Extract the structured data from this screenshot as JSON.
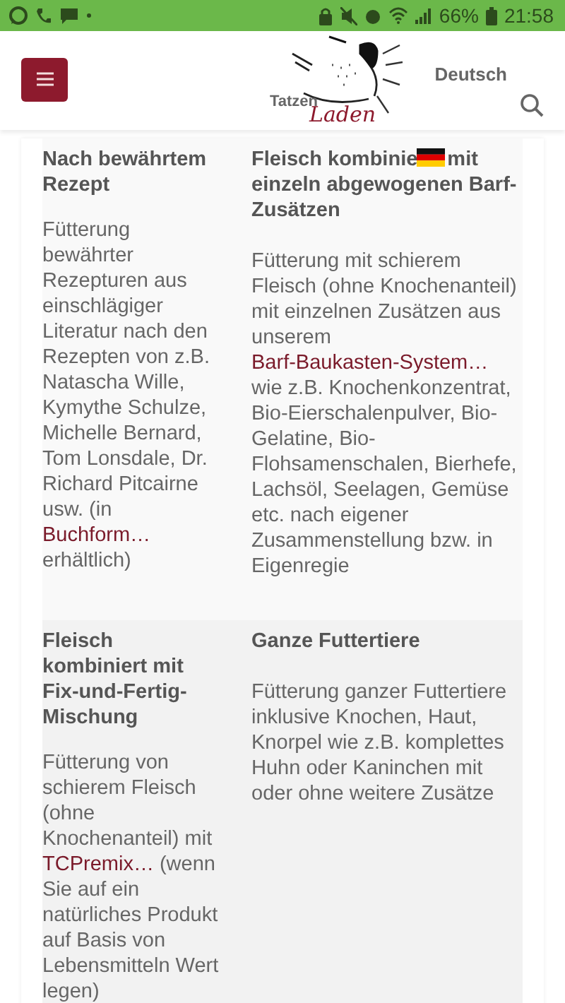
{
  "status_bar": {
    "battery": "66%",
    "time": "21:58"
  },
  "header": {
    "logo": {
      "word_1": "Tatzen",
      "word_2": "Laden"
    },
    "language": "Deutsch"
  },
  "table": {
    "rows": [
      {
        "cells": [
          {
            "heading": [
              "Nach bewährtem Rezept"
            ],
            "body": [
              {
                "kind": "text",
                "text": "Fütterung bewährter Rezepturen aus einschlägiger Literatur nach den Rezepten von z.B. Natascha Wille, Kymythe Schulze, Michelle Bernard, Tom Lonsdale, Dr. Richard Pitcairne usw. (in "
              },
              {
                "kind": "link",
                "text": "Buchform…"
              },
              {
                "kind": "text",
                "text": " erhältlich)"
              }
            ]
          },
          {
            "heading": [
              "Fleisch kombinie",
              "mit",
              "einzeln abgewogenen Barf-Zusätzen"
            ],
            "body": [
              {
                "kind": "text",
                "text": "Fütterung mit schierem Fleisch (ohne Knochenanteil) mit einzelnen Zusätzen aus unserem "
              },
              {
                "kind": "link",
                "text": "Barf-Baukasten-System…"
              },
              {
                "kind": "text",
                "text": " wie z.B. Knochenkonzentrat, Bio-Eierschalenpulver, Bio-Gelatine, Bio-Flohsamenschalen, Bierhefe, Lachsöl, Seelagen, Gemüse etc. nach eigener Zusammenstellung bzw. in Eigenregie"
              }
            ]
          }
        ]
      },
      {
        "cells": [
          {
            "heading": [
              "Fleisch kombiniert mit Fix-und-Fertig-Mischung"
            ],
            "body": [
              {
                "kind": "text",
                "text": "Fütterung von schierem Fleisch (ohne Knochenanteil) mit "
              },
              {
                "kind": "link",
                "text": "TCPremix…"
              },
              {
                "kind": "text",
                "text": " (wenn Sie auf ein natürliches Produkt auf Basis von Lebensmitteln Wert legen)"
              }
            ]
          },
          {
            "heading": [
              "Ganze Futtertiere"
            ],
            "body": [
              {
                "kind": "text",
                "text": "Fütterung ganzer Futtertiere inklusive Knochen, Haut, Knorpel wie z.B. komplettes Huhn oder Kaninchen mit oder ohne weitere Zusätze"
              }
            ]
          }
        ]
      }
    ]
  }
}
